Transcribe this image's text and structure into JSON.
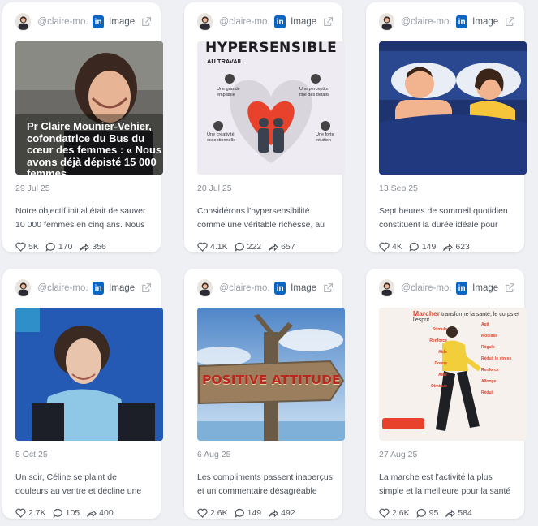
{
  "cards": [
    {
      "handle": "@claire-mo...",
      "type_label": "Image",
      "date": "29 Jul 25",
      "text": "Notre objectif initial était de sauver 10 000 femmes en cinq ans. Nous en...",
      "likes": "5K",
      "comments": "170",
      "shares": "356",
      "image_caption": "Pr Claire Mounier-Vehier, cofondatrice du Bus du cœur des femmes : « Nous avons déjà dépisté 15 000 femmes"
    },
    {
      "handle": "@claire-mo...",
      "type_label": "Image",
      "date": "20 Jul 25",
      "text": "Considérons l'hypersensibilité comme une véritable richesse, au lieu de la...",
      "likes": "4.1K",
      "comments": "222",
      "shares": "657",
      "image_title": "HYPERSENSIBLE",
      "image_subtitle": "AU TRAVAIL",
      "image_labels": [
        "Une grande empathie",
        "Une perception fine des détails",
        "Une créativité exceptionnelle",
        "Une forte intuition"
      ]
    },
    {
      "handle": "@claire-mo...",
      "type_label": "Image",
      "date": "13 Sep 25",
      "text": "Sept heures de sommeil quotidien constituent la durée idéale pour les...",
      "likes": "4K",
      "comments": "149",
      "shares": "623"
    },
    {
      "handle": "@claire-mo...",
      "type_label": "Image",
      "date": "5 Oct 25",
      "text": "Un soir, Céline se plaint de douleurs au ventre et décline une invitation à sorti...",
      "likes": "2.7K",
      "comments": "105",
      "shares": "400"
    },
    {
      "handle": "@claire-mo...",
      "type_label": "Image",
      "date": "6 Aug 25",
      "text": "Les compliments passent inaperçus et un commentaire désagréable retient...",
      "likes": "2.6K",
      "comments": "149",
      "shares": "492",
      "image_sign": "POSITIVE ATTITUDE"
    },
    {
      "handle": "@claire-mo...",
      "type_label": "Image",
      "date": "27 Aug 25",
      "text": "La marche est l'activité la plus simple et la meilleure pour la santé 😊 Et en...",
      "likes": "2.6K",
      "comments": "95",
      "shares": "584",
      "image_title_a": "Marcher",
      "image_title_b": "transforme la santé, le corps et l'esprit",
      "image_labels_left": [
        "Stimule",
        "Renforce",
        "Aide",
        "Donne",
        "Aide",
        "Diminue"
      ],
      "image_labels_right": [
        "Agit",
        "Mobilise",
        "Régule",
        "Réduit le stress",
        "Renforce",
        "Allonge",
        "Réduit"
      ]
    }
  ],
  "colors": {
    "linkedin": "#0a66c2",
    "accent_red": "#e8412c"
  }
}
